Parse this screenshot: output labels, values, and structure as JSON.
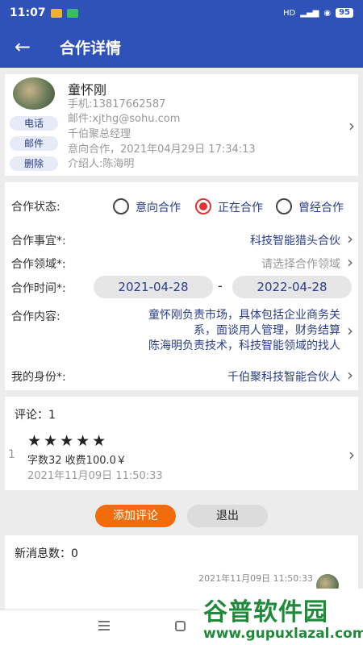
{
  "status_bar": {
    "time": "11:07",
    "signal_text": "HD",
    "battery": "95"
  },
  "appbar": {
    "title": "合作详情",
    "back_icon": "arrow-left-icon"
  },
  "contact": {
    "name": "童怀刚",
    "phone": "手机:13817662587",
    "email": "邮件:xjthg@sohu.com",
    "title": "千伯聚总经理",
    "intent": "意向合作，2021年04月29日 17:34:13",
    "referrer": "介绍人:陈海明",
    "actions": {
      "call": "电话",
      "mail": "邮件",
      "delete": "删除"
    }
  },
  "form": {
    "status_label": "合作状态:",
    "status_options": [
      "意向合作",
      "正在合作",
      "曾经合作"
    ],
    "status_selected": "正在合作",
    "matter_label": "合作事宜*:",
    "matter_value": "科技智能猎头合伙",
    "field_label": "合作领域*:",
    "field_placeholder": "请选择合作领域",
    "time_label": "合作时间*:",
    "start_date": "2021-04-28",
    "date_sep": "-",
    "end_date": "2022-04-28",
    "content_label": "合作内容:",
    "content_lines": [
      "童怀刚负责市场，具体包括企业商务关",
      "系，面谈用人管理，财务结算",
      "陈海明负责技术，科技智能领域的找人"
    ],
    "identity_label": "我的身份*:",
    "identity_value": "千伯聚科技智能合伙人"
  },
  "comments": {
    "header": "评论：1",
    "item": {
      "index": "1",
      "rating": 5,
      "stars": "★★★★★",
      "summary": "字数32 收费100.0￥",
      "time": "2021年11月09日 11:50:33"
    }
  },
  "buttons": {
    "add_comment": "添加评论",
    "exit": "退出"
  },
  "messages": {
    "header": "新消息数：0",
    "last_time": "2021年11月09日 11:50:33"
  },
  "watermark": {
    "title": "谷普软件园",
    "url": "www.gupuxlazal.com"
  },
  "colors": {
    "primary": "#2f52b8",
    "accent_orange": "#f26c0d",
    "selected_radio": "#d33333",
    "link_text": "#2a3d8a"
  }
}
